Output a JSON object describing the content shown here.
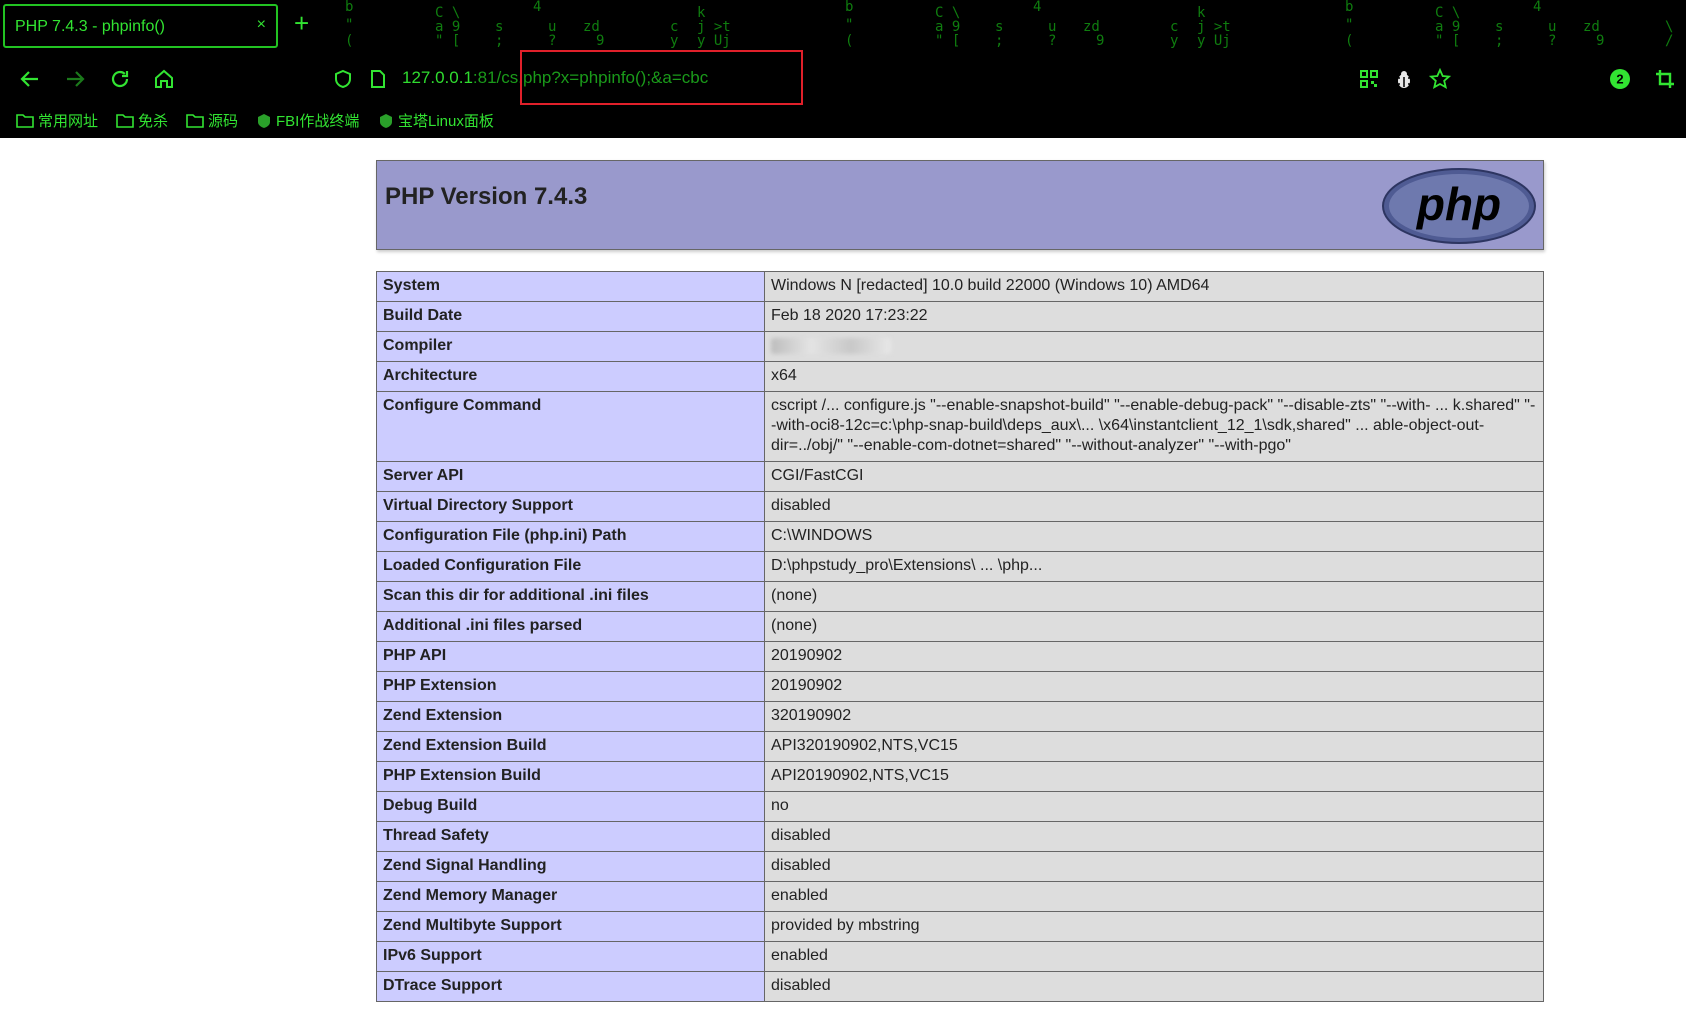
{
  "browser": {
    "tab_title": "PHP 7.4.3 - phpinfo()",
    "tab_close": "×",
    "new_tab": "+",
    "url_host": "127.0.0.1",
    "url_port": ":81/",
    "url_path": "cs.php?x=phpinfo();&a=cbc",
    "notification_count": "2",
    "bookmarks": [
      "常用网址",
      "免杀",
      "源码",
      "FBI作战终端",
      "宝塔Linux面板"
    ],
    "accent": "#32e432",
    "highlight_box": "#e0202a"
  },
  "page": {
    "title": "PHP Version 7.4.3",
    "logo_text": "php",
    "header_bg": "#9999cc",
    "label_bg": "#ccccff",
    "value_bg": "#dddddd",
    "rows": [
      {
        "label": "System",
        "value": "Windows N [redacted] 10.0 build 22000 (Windows 10) AMD64"
      },
      {
        "label": "Build Date",
        "value": "Feb 18 2020 17:23:22"
      },
      {
        "label": "Compiler",
        "value": ""
      },
      {
        "label": "Architecture",
        "value": "x64"
      },
      {
        "label": "Configure Command",
        "value": "cscript /... configure.js \"--enable-snapshot-build\" \"--enable-debug-pack\" \"--disable-zts\" \"--with- ... k.shared\" \"--with-oci8-12c=c:\\php-snap-build\\deps_aux\\... \\x64\\instantclient_12_1\\sdk,shared\" ... able-object-out-dir=../obj/\" \"--enable-com-dotnet=shared\" \"--without-analyzer\" \"--with-pgo\""
      },
      {
        "label": "Server API",
        "value": "CGI/FastCGI"
      },
      {
        "label": "Virtual Directory Support",
        "value": "disabled"
      },
      {
        "label": "Configuration File (php.ini) Path",
        "value": "C:\\WINDOWS"
      },
      {
        "label": "Loaded Configuration File",
        "value": "D:\\phpstudy_pro\\Extensions\\ ... \\php..."
      },
      {
        "label": "Scan this dir for additional .ini files",
        "value": "(none)"
      },
      {
        "label": "Additional .ini files parsed",
        "value": "(none)"
      },
      {
        "label": "PHP API",
        "value": "20190902"
      },
      {
        "label": "PHP Extension",
        "value": "20190902"
      },
      {
        "label": "Zend Extension",
        "value": "320190902"
      },
      {
        "label": "Zend Extension Build",
        "value": "API320190902,NTS,VC15"
      },
      {
        "label": "PHP Extension Build",
        "value": "API20190902,NTS,VC15"
      },
      {
        "label": "Debug Build",
        "value": "no"
      },
      {
        "label": "Thread Safety",
        "value": "disabled"
      },
      {
        "label": "Zend Signal Handling",
        "value": "disabled"
      },
      {
        "label": "Zend Memory Manager",
        "value": "enabled"
      },
      {
        "label": "Zend Multibyte Support",
        "value": "provided by mbstring"
      },
      {
        "label": "IPv6 Support",
        "value": "enabled"
      },
      {
        "label": "DTrace Support",
        "value": "disabled"
      }
    ]
  }
}
